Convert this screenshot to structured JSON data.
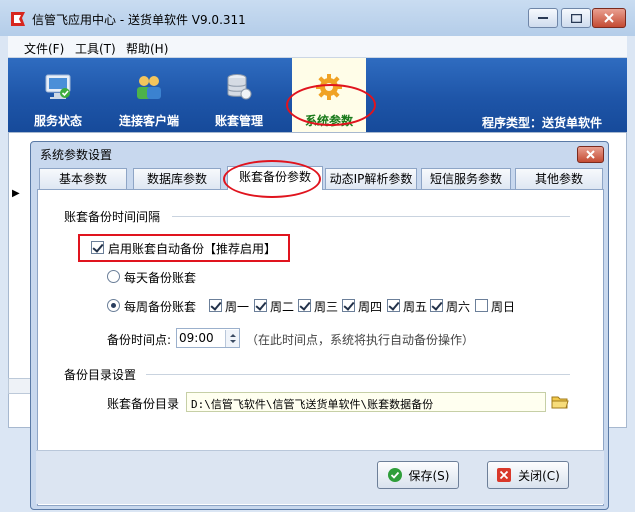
{
  "window": {
    "title": "信管飞应用中心 - 送货单软件 V9.0.311"
  },
  "menu": [
    {
      "label": "文件(F)"
    },
    {
      "label": "工具(T)"
    },
    {
      "label": "帮助(H)"
    }
  ],
  "toolbar": {
    "items": [
      {
        "label": "服务状态",
        "icon": "monitor-icon"
      },
      {
        "label": "连接客户端",
        "icon": "users-icon"
      },
      {
        "label": "账套管理",
        "icon": "database-icon"
      },
      {
        "label": "系统参数",
        "icon": "gear-icon"
      }
    ],
    "program_type": "程序类型：送货单软件"
  },
  "dialog": {
    "title": "系统参数设置",
    "tabs": [
      {
        "label": "基本参数"
      },
      {
        "label": "数据库参数"
      },
      {
        "label": "账套备份参数"
      },
      {
        "label": "动态IP解析参数"
      },
      {
        "label": "短信服务参数"
      },
      {
        "label": "其他参数"
      }
    ],
    "active_tab": "账套备份参数",
    "backup_interval": {
      "group_label": "账套备份时间间隔",
      "auto_backup_label": "启用账套自动备份【推荐启用】",
      "auto_backup_checked": true,
      "daily_label": "每天备份账套",
      "weekly_label": "每周备份账套",
      "weekdays": [
        {
          "label": "周一",
          "checked": true
        },
        {
          "label": "周二",
          "checked": true
        },
        {
          "label": "周三",
          "checked": true
        },
        {
          "label": "周四",
          "checked": true
        },
        {
          "label": "周五",
          "checked": true
        },
        {
          "label": "周六",
          "checked": true
        },
        {
          "label": "周日",
          "checked": false
        }
      ],
      "time_label": "备份时间点:",
      "time_value": "09:00",
      "time_hint": "（在此时间点，系统将执行自动备份操作）"
    },
    "backup_dir": {
      "group_label": "备份目录设置",
      "dir_label": "账套备份目录",
      "dir_value": "D:\\信管飞软件\\信管飞送货单软件\\账套数据备份"
    },
    "buttons": {
      "save_label": "保存(S)",
      "close_label": "关闭(C)"
    }
  },
  "colors": {
    "toolbar_blue": "#1e55a8",
    "highlight_red": "#e0141e",
    "active_tool_text": "#1a7a1a"
  }
}
